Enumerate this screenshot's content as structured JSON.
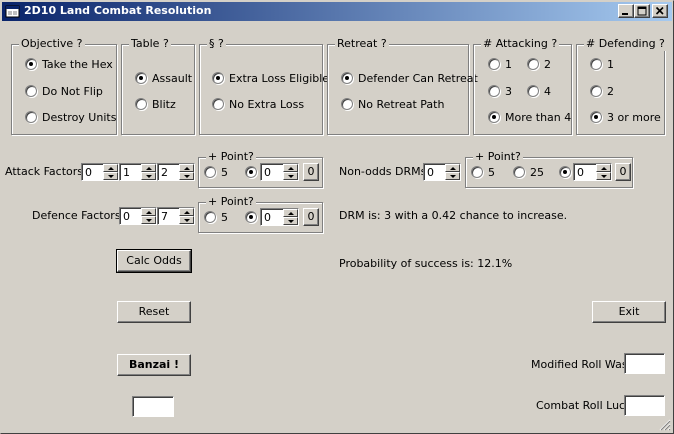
{
  "window": {
    "title": "2D10 Land Combat Resolution"
  },
  "groups": {
    "objective": {
      "legend": "Objective ?",
      "options": [
        "Take the Hex",
        "Do Not Flip",
        "Destroy Units"
      ],
      "selected": "Take the Hex"
    },
    "table": {
      "legend": "Table ?",
      "options": [
        "Assault",
        "Blitz"
      ],
      "selected": "Assault"
    },
    "section": {
      "legend": "§ ?",
      "options": [
        "Extra Loss Eligible",
        "No Extra Loss"
      ],
      "selected": "Extra Loss Eligible"
    },
    "retreat": {
      "legend": "Retreat ?",
      "options": [
        "Defender Can Retreat",
        "No Retreat Path"
      ],
      "selected": "Defender Can Retreat"
    },
    "attacking": {
      "legend": "# Attacking ?",
      "options": [
        "1",
        "2",
        "3",
        "4",
        "More than 4"
      ],
      "selected": "More than 4"
    },
    "defending": {
      "legend": "# Defending ?",
      "options": [
        "1",
        "2",
        "3 or more"
      ],
      "selected": "3 or more"
    }
  },
  "attack": {
    "label": "Attack Factors:",
    "values": [
      "0",
      "1",
      "2"
    ],
    "point": {
      "legend": "+ Point?",
      "opt1": "5",
      "value": "0",
      "button": "0"
    }
  },
  "defence": {
    "label": "Defence Factors:",
    "values": [
      "0",
      "7"
    ],
    "point": {
      "legend": "+ Point?",
      "opt1": "5",
      "value": "0",
      "button": "0"
    }
  },
  "nonodds": {
    "label": "Non-odds DRMs",
    "value": "0",
    "point": {
      "legend": "+ Point?",
      "opt1": "5",
      "opt2": "25",
      "value": "0",
      "button": "0"
    }
  },
  "results": {
    "drm": "DRM is: 3 with a 0.42 chance to increase.",
    "probability": "Probability of success is: 12.1%"
  },
  "buttons": {
    "calc": "Calc Odds",
    "reset": "Reset",
    "banzai": "Banzai !",
    "exit": "Exit"
  },
  "outputs": {
    "modified_label": "Modified Roll Was",
    "modified_value": "",
    "luck_label": "Combat Roll Luck",
    "luck_value": "",
    "banzai_value": ""
  }
}
